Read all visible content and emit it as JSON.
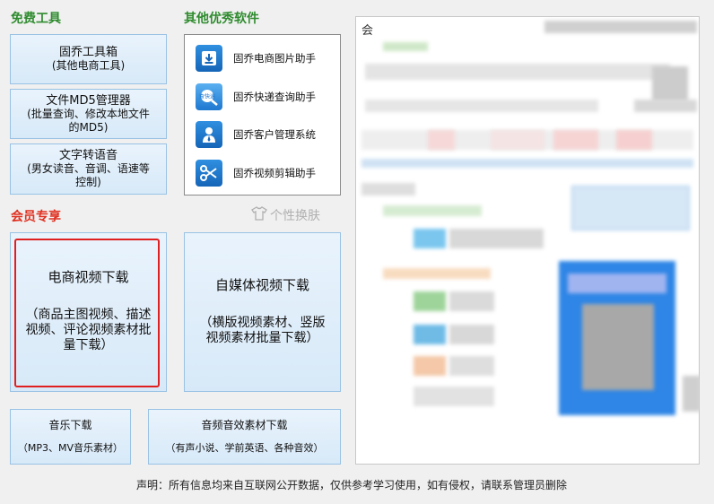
{
  "free_tools": {
    "title": "免费工具",
    "buttons": [
      {
        "line1": "固乔工具箱",
        "line2": "(其他电商工具)"
      },
      {
        "line1": "文件MD5管理器",
        "line2": "(批量查询、修改本地文件\n的MD5)"
      },
      {
        "line1": "文字转语音",
        "line2": "(男女读音、音调、语速等\n控制)"
      }
    ]
  },
  "other_software": {
    "title": "其他优秀软件",
    "items": [
      {
        "label": "固乔电商图片助手",
        "icon": "download-icon"
      },
      {
        "label": "固乔快递查询助手",
        "icon": "express-search-icon"
      },
      {
        "label": "固乔客户管理系统",
        "icon": "customer-icon"
      },
      {
        "label": "固乔视频剪辑助手",
        "icon": "scissors-icon"
      }
    ]
  },
  "member": {
    "title": "会员专享",
    "skin_label": "个性换肤",
    "big_buttons": [
      {
        "line1": "电商视频下载",
        "line2": "（商品主图视频、描述\n视频、评论视频素材批\n量下载）"
      },
      {
        "line1": "自媒体视频下载",
        "line2": "（横版视频素材、竖版\n视频素材批量下载）"
      }
    ],
    "small_buttons": [
      {
        "line1": "音乐下载",
        "line2": "（MP3、MV音乐素材）"
      },
      {
        "line1": "音频音效素材下载",
        "line2": "（有声小说、学前英语、各种音效）"
      }
    ]
  },
  "preview": {
    "corner_char": "会"
  },
  "footer": {
    "text": "声明：所有信息均来自互联网公开数据，仅供参考学习使用，如有侵权，请联系管理员删除"
  }
}
